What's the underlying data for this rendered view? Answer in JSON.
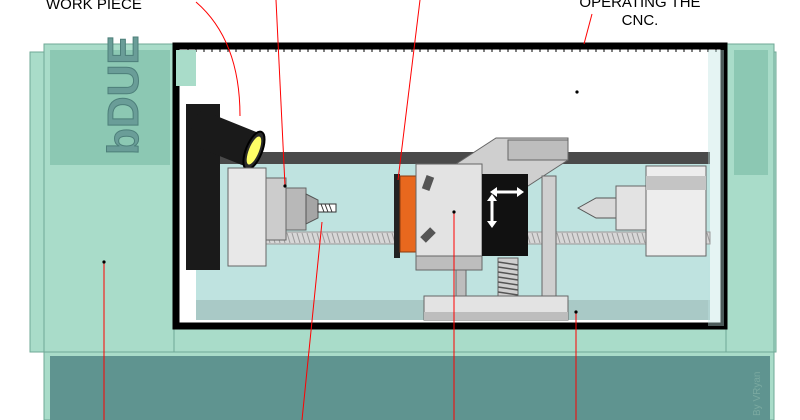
{
  "labels": {
    "work_piece": "WORK PIECE",
    "operating_line1": "OPERATING THE",
    "operating_line2": "CNC."
  },
  "brand": {
    "logo_text": "bDUE"
  },
  "credit": "By VRyan",
  "colors": {
    "machine_body": "#a9dcc9",
    "machine_body_dark": "#8cc8b3",
    "base_panel": "#5f9490",
    "cabinet_glass": "#bfe3e0",
    "frame": "#000000",
    "tool_orange": "#e8681e",
    "leader_line": "#ff0000",
    "steel_light": "#e3e3e3",
    "steel_mid": "#bdbdbd",
    "steel_dark": "#7f7f7f"
  }
}
